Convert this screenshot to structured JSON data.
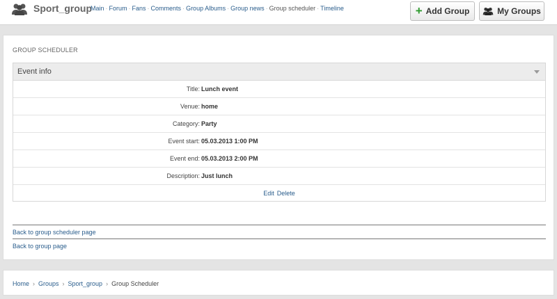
{
  "header": {
    "group_name": "Sport_group",
    "nav": [
      {
        "label": "Main"
      },
      {
        "label": "Forum"
      },
      {
        "label": "Fans"
      },
      {
        "label": "Comments"
      },
      {
        "label": "Group Albums"
      },
      {
        "label": "Group news"
      },
      {
        "label": "Group scheduler"
      },
      {
        "label": "Timeline"
      }
    ],
    "nav_separator": "·",
    "add_group_label": "Add Group",
    "my_groups_label": "My Groups"
  },
  "main": {
    "section_title": "GROUP SCHEDULER",
    "event_info_title": "Event info",
    "fields": [
      {
        "label": "Title:",
        "value": "Lunch event"
      },
      {
        "label": "Venue:",
        "value": "home"
      },
      {
        "label": "Category:",
        "value": "Party"
      },
      {
        "label": "Event start:",
        "value": "05.03.2013 1:00 PM"
      },
      {
        "label": "Event end:",
        "value": "05.03.2013 2:00 PM"
      },
      {
        "label": "Description:",
        "value": "Just lunch"
      }
    ],
    "edit_label": "Edit",
    "delete_label": "Delete",
    "back_scheduler": "Back to group scheduler page",
    "back_group": "Back to group page"
  },
  "breadcrumb": {
    "items": [
      "Home",
      "Groups",
      "Sport_group"
    ],
    "current": "Group Scheduler",
    "separator": "›"
  },
  "colors": {
    "link": "#2a5d8c",
    "plus": "#2e9a2e"
  }
}
